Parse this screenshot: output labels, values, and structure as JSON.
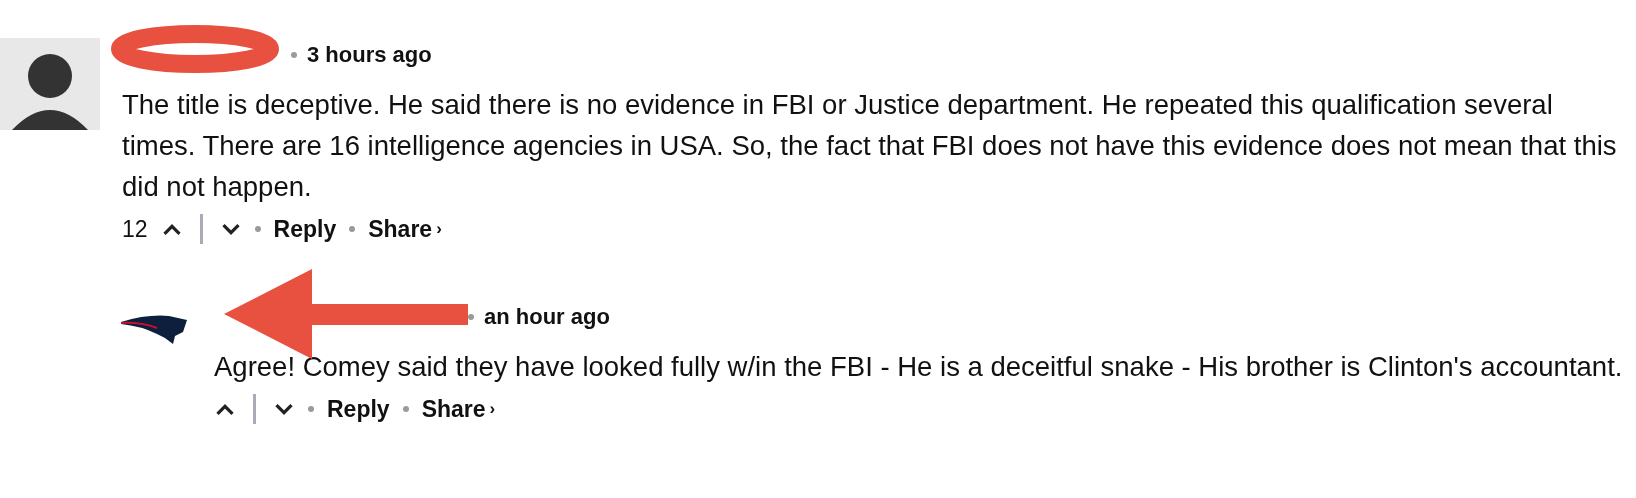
{
  "comments": [
    {
      "time": "3 hours ago",
      "body": "The title is deceptive. He said there is no evidence in FBI or Justice department. He repeated this qualification several times. There are 16 intelligence agencies in USA. So, the fact that FBI does not have this evidence does not mean that this did not happen.",
      "votes": "12",
      "reply": "Reply",
      "share": "Share",
      "share_caret": "›",
      "annotation": {
        "kind": "ellipse"
      },
      "children": [
        {
          "time": "an hour ago",
          "body": "Agree! Comey said they have looked fully w/in the FBI - He is a deceitful snake - His brother is Clinton's accountant.",
          "reply": "Reply",
          "share": "Share",
          "share_caret": "›",
          "annotation": {
            "kind": "arrow"
          }
        }
      ]
    }
  ]
}
